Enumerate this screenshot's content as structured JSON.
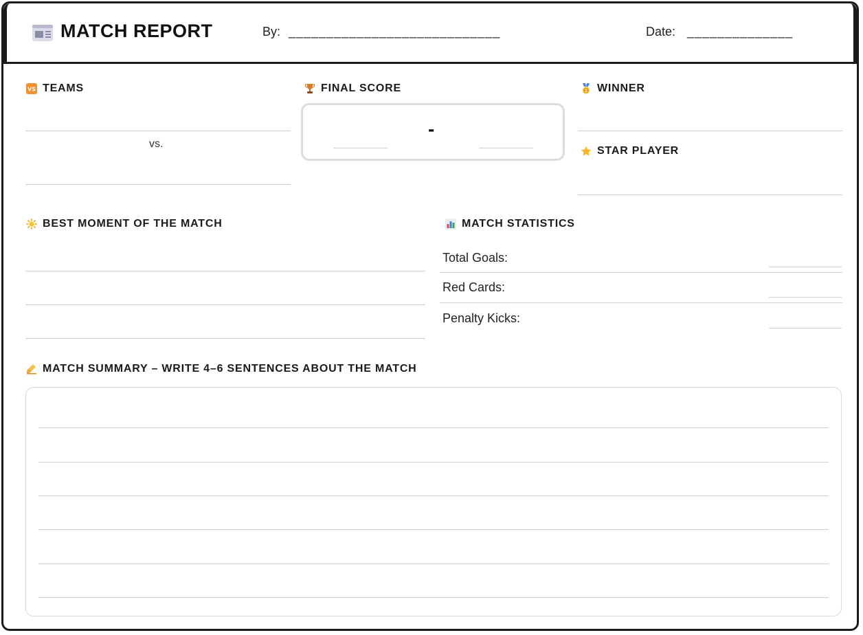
{
  "header": {
    "title": "MATCH REPORT",
    "by_label": "By:",
    "by_blank": "____________________________",
    "date_label": "Date:",
    "date_blank": "______________",
    "icon": "newspaper-icon"
  },
  "teams": {
    "label": "TEAMS",
    "vs": "vs.",
    "icon": "vs-badge-icon"
  },
  "final_score": {
    "label": "FINAL SCORE",
    "separator": "-",
    "icon": "trophy-icon"
  },
  "winner": {
    "label": "WINNER",
    "icon": "medal-icon"
  },
  "star_player": {
    "label": "STAR PLAYER",
    "icon": "star-icon"
  },
  "best_moment": {
    "label": "BEST MOMENT OF THE MATCH",
    "icon": "sun-icon"
  },
  "statistics": {
    "label": "MATCH STATISTICS",
    "icon": "bar-chart-icon",
    "rows": [
      "Total Goals:",
      "Red Cards:",
      "Penalty Kicks:"
    ]
  },
  "summary": {
    "label": "MATCH SUMMARY – WRITE 4–6 SENTENCES ABOUT THE MATCH",
    "icon": "writing-hand-icon"
  },
  "colors": {
    "accent_orange": "#f4902c",
    "border": "#1a1a1a",
    "rule": "#cfcfcf"
  }
}
